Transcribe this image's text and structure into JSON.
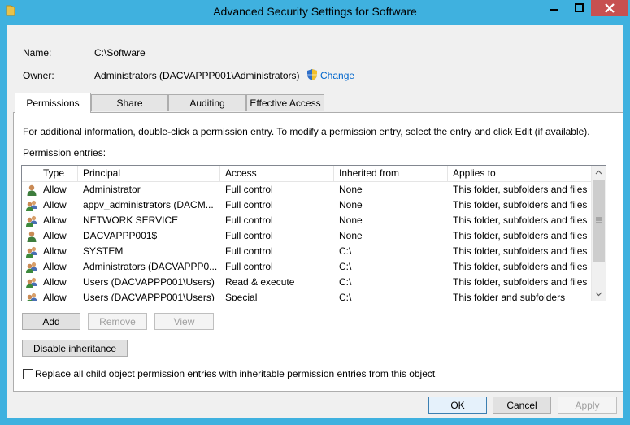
{
  "window": {
    "title": "Advanced Security Settings for Software",
    "controls": {
      "minimize": "minimize",
      "maximize": "maximize",
      "close": "close"
    }
  },
  "object": {
    "name_label": "Name:",
    "name_value": "C:\\Software",
    "owner_label": "Owner:",
    "owner_value": "Administrators (DACVAPPP001\\Administrators)",
    "change_link": "Change"
  },
  "tabs": [
    {
      "label": "Permissions",
      "active": true
    },
    {
      "label": "Share",
      "active": false
    },
    {
      "label": "Auditing",
      "active": false
    },
    {
      "label": "Effective Access",
      "active": false
    }
  ],
  "permissions": {
    "info_text": "For additional information, double-click a permission entry. To modify a permission entry, select the entry and click Edit (if available).",
    "entries_label": "Permission entries:",
    "columns": [
      "Type",
      "Principal",
      "Access",
      "Inherited from",
      "Applies to"
    ],
    "rows": [
      {
        "icon": "user-icon",
        "type": "Allow",
        "principal": "Administrator",
        "access": "Full control",
        "inherited": "None",
        "applies": "This folder, subfolders and files"
      },
      {
        "icon": "group-icon",
        "type": "Allow",
        "principal": "appv_administrators (DACM...",
        "access": "Full control",
        "inherited": "None",
        "applies": "This folder, subfolders and files"
      },
      {
        "icon": "group-icon",
        "type": "Allow",
        "principal": "NETWORK SERVICE",
        "access": "Full control",
        "inherited": "None",
        "applies": "This folder, subfolders and files"
      },
      {
        "icon": "user-icon",
        "type": "Allow",
        "principal": "DACVAPPP001$",
        "access": "Full control",
        "inherited": "None",
        "applies": "This folder, subfolders and files"
      },
      {
        "icon": "group-icon",
        "type": "Allow",
        "principal": "SYSTEM",
        "access": "Full control",
        "inherited": "C:\\",
        "applies": "This folder, subfolders and files"
      },
      {
        "icon": "group-icon",
        "type": "Allow",
        "principal": "Administrators (DACVAPPP0...",
        "access": "Full control",
        "inherited": "C:\\",
        "applies": "This folder, subfolders and files"
      },
      {
        "icon": "group-icon",
        "type": "Allow",
        "principal": "Users (DACVAPPP001\\Users)",
        "access": "Read & execute",
        "inherited": "C:\\",
        "applies": "This folder, subfolders and files"
      },
      {
        "icon": "group-icon",
        "type": "Allow",
        "principal": "Users (DACVAPPP001\\Users)",
        "access": "Special",
        "inherited": "C:\\",
        "applies": "This folder and subfolders"
      }
    ],
    "add_button": "Add",
    "remove_button": "Remove",
    "view_button": "View",
    "disable_inheritance_button": "Disable inheritance",
    "replace_checkbox_label": "Replace all child object permission entries with inheritable permission entries from this object",
    "replace_checked": false
  },
  "footer": {
    "ok_button": "OK",
    "cancel_button": "Cancel",
    "apply_button": "Apply"
  },
  "colors": {
    "frame": "#3fb1df",
    "close_button": "#c75050",
    "link": "#0066cc"
  }
}
